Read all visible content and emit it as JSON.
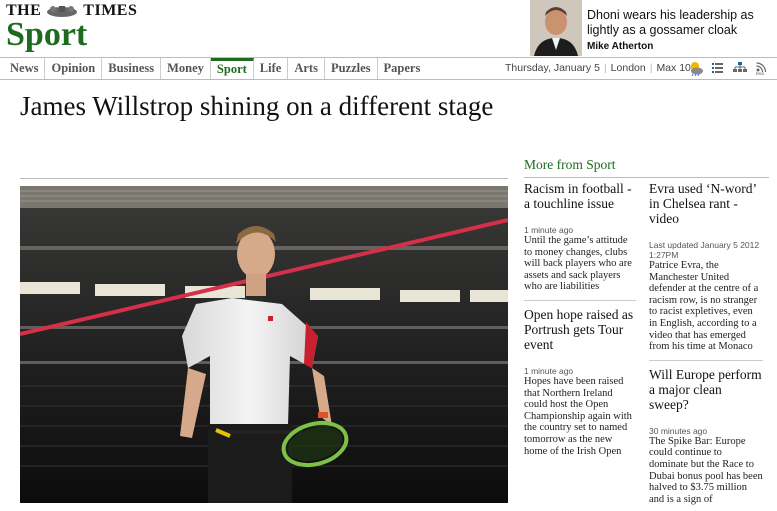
{
  "masthead": {
    "brand": "THE TIMES",
    "section": "Sport"
  },
  "promo": {
    "headline": "Dhoni wears his leadership as lightly as a gossamer cloak",
    "byline": "Mike Atherton"
  },
  "nav": {
    "items": [
      "News",
      "Opinion",
      "Business",
      "Money",
      "Sport",
      "Life",
      "Arts",
      "Puzzles",
      "Papers"
    ],
    "active": "Sport",
    "date": "Thursday, January 5",
    "location": "London",
    "weather": "Max 10C",
    "tools": [
      "weather-icon",
      "list-view-icon",
      "site-map-icon",
      "rss-icon"
    ]
  },
  "article": {
    "headline": "James Willstrop shining on a different stage"
  },
  "more": {
    "title": "More from Sport",
    "left": [
      {
        "title": "Racism in football - a touchline issue",
        "stamp": "1 minute ago",
        "summary": "Until the game’s attitude to money changes, clubs will back players who are assets and sack players who are liabilities"
      },
      {
        "title": "Open hope raised as Portrush gets Tour event",
        "stamp": "1 minute ago",
        "summary": "Hopes have been raised that Northern Ireland could host the Open Championship again with the country set to named tomorrow as the new home of the Irish Open"
      }
    ],
    "right": [
      {
        "title": "Evra used ‘N-word’ in Chelsea rant - video",
        "stamp": "Last updated January 5 2012 1:27PM",
        "summary": "Patrice Evra, the Manchester United defender at the centre of a racism row, is no stranger to racist expletives, even in English, according to a video that has emerged from his time at Monaco"
      },
      {
        "title": "Will Europe perform a major clean sweep?",
        "stamp": "30 minutes ago",
        "summary": "The Spike Bar: Europe could continue to dominate but the Race to Dubai bonus pool has been halved to $3.75 million and is a sign of"
      }
    ]
  },
  "colors": {
    "brand_green": "#1e6a1e",
    "laser_red": "#d4304a",
    "racket_green": "#7cc244"
  }
}
